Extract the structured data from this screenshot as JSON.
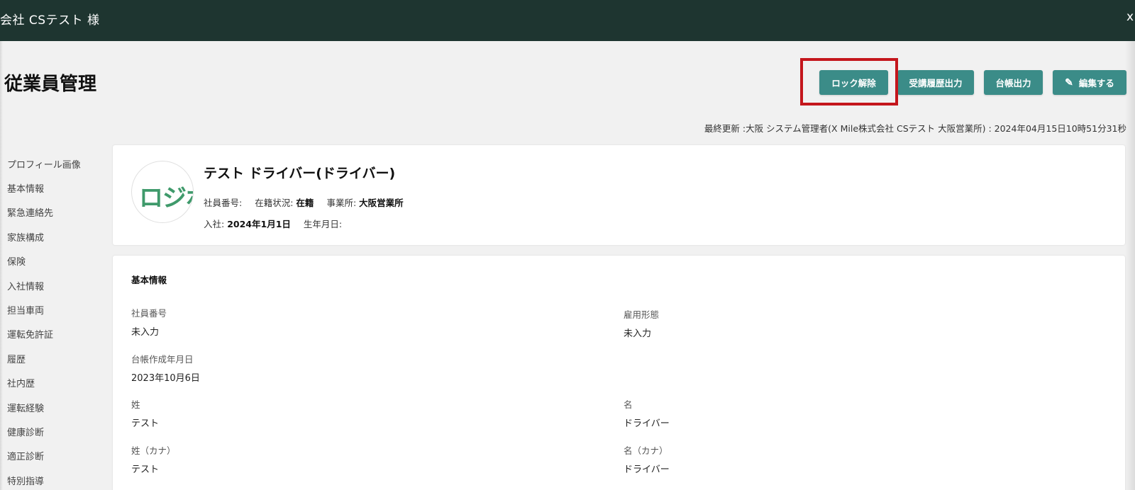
{
  "window": {
    "title": "会社 CSテスト 様",
    "close_label": "x"
  },
  "page": {
    "title": "従業員管理",
    "last_updated": "最終更新 :大阪 システム管理者(X Mile株式会社 CSテスト 大阪営業所) : 2024年04月15日10時51分31秒"
  },
  "toolbar": {
    "unlock_label": "ロック解除",
    "history_export_label": "受講履歴出力",
    "ledger_export_label": "台帳出力",
    "edit_label": "編集する"
  },
  "sidenav": {
    "items": [
      {
        "label": "プロフィール画像"
      },
      {
        "label": "基本情報"
      },
      {
        "label": "緊急連絡先"
      },
      {
        "label": "家族構成"
      },
      {
        "label": "保険"
      },
      {
        "label": "入社情報"
      },
      {
        "label": "担当車両"
      },
      {
        "label": "運転免許証"
      },
      {
        "label": "履歴"
      },
      {
        "label": "社内歴"
      },
      {
        "label": "運転経験"
      },
      {
        "label": "健康診断"
      },
      {
        "label": "適正診断"
      },
      {
        "label": "特別指導"
      }
    ]
  },
  "profile": {
    "avatar_text": "ロジボ",
    "name": "テスト ドライバー(ドライバー)",
    "employee_no_label": "社員番号:",
    "employee_no_value": "",
    "status_label": "在籍状況:",
    "status_value": "在籍",
    "office_label": "事業所:",
    "office_value": "大阪営業所",
    "joined_label": "入社:",
    "joined_value": "2024年1月1日",
    "birthday_label": "生年月日:",
    "birthday_value": ""
  },
  "basic_info": {
    "section_title": "基本情報",
    "fields": {
      "employee_no": {
        "label": "社員番号",
        "value": "未入力"
      },
      "employment_type": {
        "label": "雇用形態",
        "value": "未入力"
      },
      "ledger_date": {
        "label": "台帳作成年月日",
        "value": "2023年10月6日"
      },
      "last_name": {
        "label": "姓",
        "value": "テスト"
      },
      "first_name": {
        "label": "名",
        "value": "ドライバー"
      },
      "last_name_kana": {
        "label": "姓（カナ）",
        "value": "テスト"
      },
      "first_name_kana": {
        "label": "名（カナ）",
        "value": "ドライバー"
      }
    }
  },
  "colors": {
    "header_bg": "#1e3530",
    "button_bg": "#3b8c88",
    "highlight": "#c4161c",
    "logo": "#3f9a6b"
  }
}
